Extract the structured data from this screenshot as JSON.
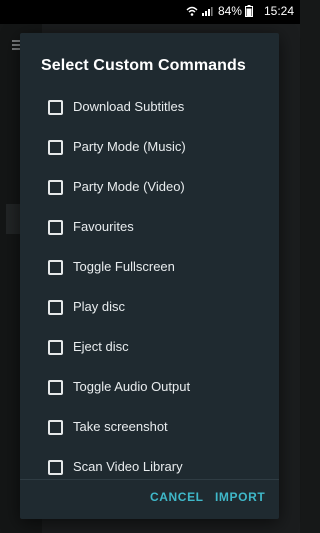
{
  "status_bar": {
    "battery_percent": "84%",
    "time": "15:24",
    "icons": [
      "wifi-icon",
      "signal-icon",
      "battery-icon"
    ]
  },
  "dialog": {
    "title": "Select Custom Commands",
    "items": [
      {
        "label": "Download Subtitles",
        "checked": false
      },
      {
        "label": "Party Mode (Music)",
        "checked": false
      },
      {
        "label": "Party Mode (Video)",
        "checked": false
      },
      {
        "label": "Favourites",
        "checked": false
      },
      {
        "label": "Toggle Fullscreen",
        "checked": false
      },
      {
        "label": "Play disc",
        "checked": false
      },
      {
        "label": "Eject disc",
        "checked": false
      },
      {
        "label": "Toggle Audio Output",
        "checked": false
      },
      {
        "label": "Take screenshot",
        "checked": false
      },
      {
        "label": "Scan Video Library",
        "checked": false
      }
    ],
    "cancel_label": "CANCEL",
    "import_label": "IMPORT"
  },
  "colors": {
    "accent": "#3fb8c9",
    "dialog_bg": "#1f2a30",
    "text": "#e8ecee"
  }
}
